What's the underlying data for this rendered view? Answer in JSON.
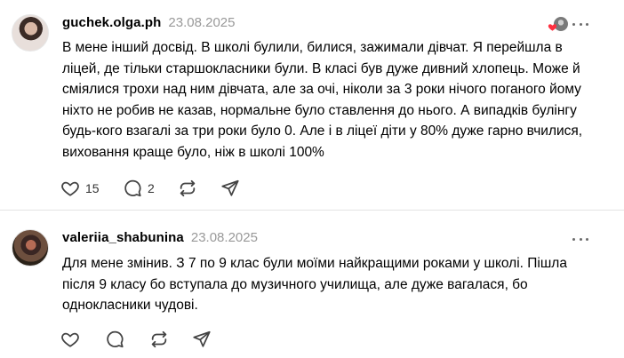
{
  "posts": [
    {
      "username": "guchek.olga.ph",
      "date": "23.08.2025",
      "text": "В мене інший досвід. В школі булили, билися, зажимали дівчат. Я перейшла в ліцей, де тільки старшокласники були. В класі був дуже дивний хлопець. Може й сміялися трохи над ним дівчата, але за очі, ніколи за 3 роки нічого поганого йому ніхто не робив не казав, нормальне було ставлення до нього. А випадків булінгу будь-кого взагалі за три роки було 0. Але і в ліцеї діти у 80% дуже гарно вчилися, виховання краще було, ніж в школі 100%",
      "likes": "15",
      "replies": "2",
      "liked_by_author_badge": true,
      "icons": [
        "heart-icon",
        "comment-icon",
        "repost-icon",
        "share-icon",
        "more-icon"
      ]
    },
    {
      "username": "valeriia_shabunina",
      "date": "23.08.2025",
      "text": "Для мене змінив. З 7 по 9 клас були моїми найкращими роками у школі. Пішла після 9 класу бо вступала до музичного училища, але дуже вагалася, бо однокласники чудові.",
      "likes": "",
      "replies": "",
      "liked_by_author_badge": false,
      "icons": [
        "heart-icon",
        "comment-icon",
        "repost-icon",
        "share-icon",
        "more-icon"
      ]
    }
  ],
  "colors": {
    "text": "#000000",
    "muted": "#999999",
    "icon": "#424242",
    "liked_heart": "#ff3040",
    "divider": "#e3e3e3"
  }
}
